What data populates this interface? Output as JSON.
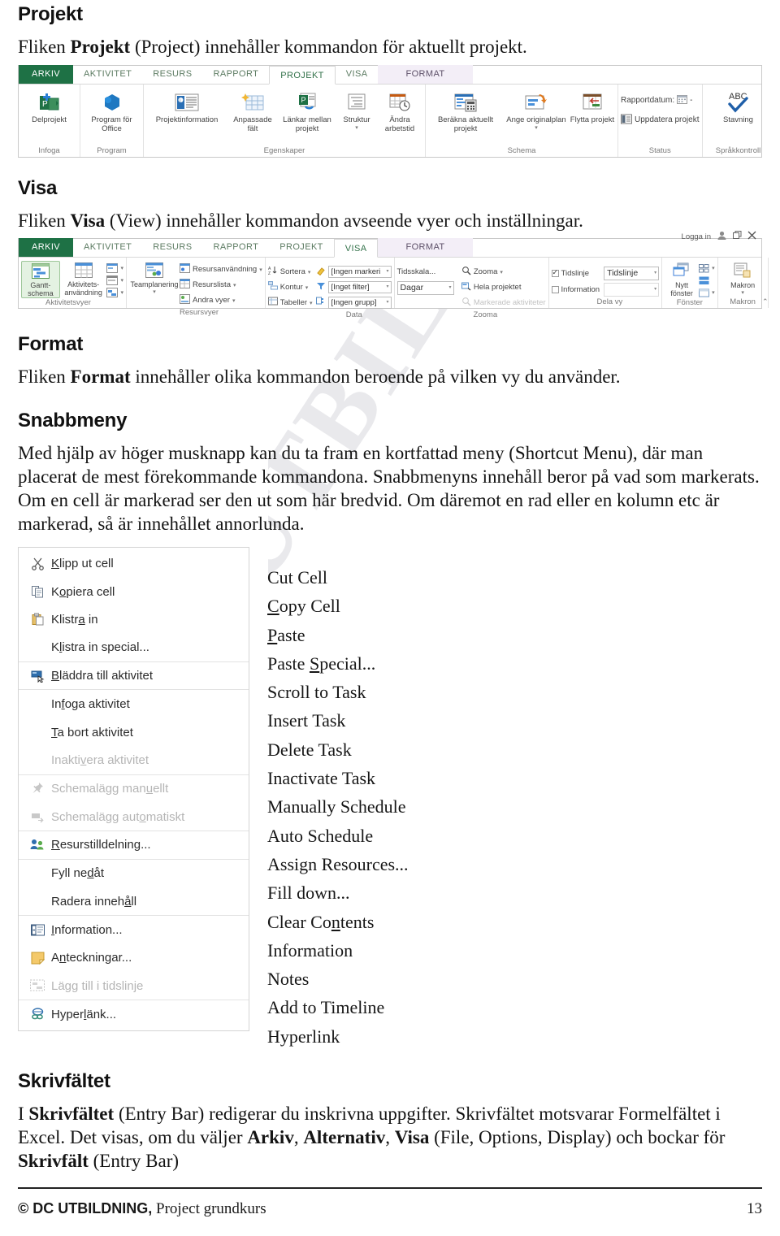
{
  "watermark": {
    "text": "UTBILDNING"
  },
  "sections": {
    "projekt": {
      "heading": "Projekt",
      "paragraph_pre": "Fliken ",
      "paragraph_bold": "Projekt",
      "paragraph_post": " (Project) innehåller kommandon för aktuellt projekt."
    },
    "visa": {
      "heading": "Visa",
      "paragraph_pre": "Fliken ",
      "paragraph_bold": "Visa",
      "paragraph_post": " (View) innehåller kommandon avseende vyer och inställningar."
    },
    "format": {
      "heading": "Format",
      "paragraph_pre": "Fliken ",
      "paragraph_bold": "Format",
      "paragraph_post": " innehåller olika kommandon beroende på vilken vy du använder."
    },
    "snabbmeny": {
      "heading": "Snabbmeny",
      "paragraph": "Med hjälp av höger musknapp kan du ta fram en kortfattad meny (Shortcut Menu), där man placerat de mest förekommande kommandona. Snabbmenyns innehåll beror på vad som markerats. Om en cell är markerad ser den ut som här bredvid. Om däremot en rad eller en kolumn etc är markerad, så är innehållet annorlunda."
    },
    "skrivfaltet": {
      "heading": "Skrivfältet",
      "p1_pre": "I ",
      "p1_b1": "Skrivfältet",
      "p1_mid1": " (Entry Bar) redigerar du inskrivna uppgifter. Skrivfältet motsvarar Formelfältet i Excel. Det visas, om du väljer ",
      "p1_b2": "Arkiv",
      "p1_sep1": ", ",
      "p1_b3": "Alternativ",
      "p1_sep2": ", ",
      "p1_b4": "Visa",
      "p1_mid2": " (File, Options, Display) och bockar för ",
      "p1_b5": "Skrivfält",
      "p1_end": " (Entry Bar)"
    }
  },
  "ribbon_projekt": {
    "tabs": [
      {
        "label": "ARKIV",
        "state": "file"
      },
      {
        "label": "AKTIVITET",
        "state": "normal"
      },
      {
        "label": "RESURS",
        "state": "normal"
      },
      {
        "label": "RAPPORT",
        "state": "normal"
      },
      {
        "label": "PROJEKT",
        "state": "active"
      },
      {
        "label": "VISA",
        "state": "normal"
      },
      {
        "label": "FORMAT",
        "state": "contextual"
      }
    ],
    "groups": [
      {
        "name": "Infoga",
        "buttons": [
          {
            "label": "Delprojekt",
            "icon": "subproject-icon"
          }
        ]
      },
      {
        "name": "Program",
        "buttons": [
          {
            "label": "Program för Office",
            "icon": "office-addin-icon",
            "dropdown": true
          }
        ]
      },
      {
        "name": "Egenskaper",
        "buttons": [
          {
            "label": "Projektinformation",
            "icon": "project-information-icon"
          },
          {
            "label": "Anpassade fält",
            "icon": "custom-fields-icon"
          },
          {
            "label": "Länkar mellan projekt",
            "icon": "links-between-projects-icon"
          },
          {
            "label": "Struktur",
            "icon": "wbs-icon",
            "dropdown": true
          },
          {
            "label": "Ändra arbetstid",
            "icon": "change-working-time-icon"
          }
        ]
      },
      {
        "name": "Schema",
        "buttons": [
          {
            "label": "Beräkna aktuellt projekt",
            "icon": "calculate-project-icon"
          },
          {
            "label": "Ange originalplan",
            "icon": "set-baseline-icon",
            "dropdown": true
          },
          {
            "label": "Flytta projekt",
            "icon": "move-project-icon"
          }
        ]
      },
      {
        "name": "Status",
        "rows": [
          {
            "label": "Rapportdatum:",
            "icon": "calendar-icon",
            "trailing": "-"
          },
          {
            "label": "Uppdatera projekt",
            "icon": "update-project-icon"
          }
        ]
      },
      {
        "name": "Språkkontroll",
        "buttons": [
          {
            "label": "Stavning",
            "icon": "spelling-abc-icon"
          }
        ]
      }
    ]
  },
  "ribbon_visa": {
    "tabs": [
      {
        "label": "ARKIV",
        "state": "file"
      },
      {
        "label": "AKTIVITET",
        "state": "normal"
      },
      {
        "label": "RESURS",
        "state": "normal"
      },
      {
        "label": "RAPPORT",
        "state": "normal"
      },
      {
        "label": "PROJEKT",
        "state": "normal"
      },
      {
        "label": "VISA",
        "state": "active"
      },
      {
        "label": "FORMAT",
        "state": "contextual"
      }
    ],
    "window": {
      "signin": "Logga in",
      "account_icon": "account-icon",
      "restore_icon": "restore-icon",
      "close_icon": "close-icon",
      "collapse_icon": "collapse-ribbon-icon"
    },
    "groups": {
      "aktivitetsvyer": {
        "name": "Aktivitetsvyer",
        "gantt": "Gantt-schema",
        "usage": "Aktivitets-användning",
        "small_icons": [
          "task-view-1-icon",
          "task-view-2-icon",
          "task-view-3-icon"
        ]
      },
      "resursvyer": {
        "name": "Resursvyer",
        "teamplanner": "Teamplanering",
        "items": [
          {
            "label": "Resursanvändning",
            "icon": "resource-usage-icon"
          },
          {
            "label": "Resurslista",
            "icon": "resource-sheet-icon"
          },
          {
            "label": "Andra vyer",
            "icon": "other-views-icon"
          }
        ]
      },
      "data": {
        "name": "Data",
        "items": [
          {
            "label": "Sortera",
            "icon": "sort-icon"
          },
          {
            "label": "Kontur",
            "icon": "outline-icon"
          },
          {
            "label": "Tabeller",
            "icon": "tables-icon"
          }
        ],
        "combos": [
          {
            "value": "[Ingen markeri",
            "icon": "highlight-icon"
          },
          {
            "value": "[Inget filter]",
            "icon": "filter-icon"
          },
          {
            "value": "[Ingen grupp]",
            "icon": "group-icon"
          }
        ]
      },
      "zooma": {
        "name": "Zooma",
        "timescale_label": "Tidsskala...",
        "timescale_value": "Dagar",
        "items": [
          {
            "label": "Zooma",
            "icon": "zoom-icon",
            "dropdown": true,
            "dim": false
          },
          {
            "label": "Hela projektet",
            "icon": "entire-project-icon",
            "dim": false
          },
          {
            "label": "Markerade aktiviteter",
            "icon": "selected-tasks-icon",
            "dim": true
          }
        ]
      },
      "delavy": {
        "name": "Dela vy",
        "checkboxes": [
          {
            "label": "Tidslinje",
            "checked": true
          },
          {
            "label": "Information",
            "checked": false
          }
        ],
        "combos": [
          {
            "value": "Tidslinje",
            "enabled": true
          },
          {
            "value": "",
            "enabled": false
          }
        ]
      },
      "fonster": {
        "name": "Fönster",
        "newwindow": "Nytt fönster",
        "small_icons": [
          "arrange-all-icon",
          "split-icon",
          "hide-icon"
        ]
      },
      "makron": {
        "name": "Makron",
        "label": "Makron",
        "dropdown": true
      }
    }
  },
  "context_menu": {
    "items": [
      {
        "sv": "Klipp ut cell",
        "sv_u": "K",
        "en": "Cut Cell",
        "en_u": "",
        "icon": "cut-icon",
        "dim": false,
        "sep": false
      },
      {
        "sv": "Kopiera cell",
        "sv_u": "o",
        "en": "Copy Cell",
        "en_u": "C",
        "icon": "copy-icon",
        "dim": false,
        "sep": false
      },
      {
        "sv": "Klistra in",
        "sv_u": "a",
        "en": "Paste",
        "en_u": "P",
        "icon": "paste-icon",
        "dim": false,
        "sep": false
      },
      {
        "sv": "Klistra in special...",
        "sv_u": "l",
        "en": "Paste Special...",
        "en_u": "S",
        "icon": "",
        "dim": false,
        "sep": true
      },
      {
        "sv": "Bläddra till aktivitet",
        "sv_u": "B",
        "en": "Scroll to Task",
        "en_u": "",
        "icon": "scroll-to-task-icon",
        "dim": false,
        "sep": true
      },
      {
        "sv": "Infoga aktivitet",
        "sv_u": "f",
        "en": "Insert Task",
        "en_u": "",
        "icon": "",
        "dim": false,
        "sep": false
      },
      {
        "sv": "Ta bort aktivitet",
        "sv_u": "T",
        "en": "Delete Task",
        "en_u": "",
        "icon": "",
        "dim": false,
        "sep": false
      },
      {
        "sv": "Inaktivera aktivitet",
        "sv_u": "v",
        "en": "Inactivate Task",
        "en_u": "",
        "icon": "",
        "dim": true,
        "sep": true
      },
      {
        "sv": "Schemalägg manuellt",
        "sv_u": "u",
        "en": "Manually Schedule",
        "en_u": "",
        "icon": "pin-icon",
        "dim": true,
        "sep": false
      },
      {
        "sv": "Schemalägg automatiskt",
        "sv_u": "o",
        "en": "Auto Schedule",
        "en_u": "",
        "icon": "auto-schedule-icon",
        "dim": true,
        "sep": true
      },
      {
        "sv": "Resurstilldelning...",
        "sv_u": "R",
        "en": "Assign Resources...",
        "en_u": "",
        "icon": "assign-resources-icon",
        "dim": false,
        "sep": true
      },
      {
        "sv": "Fyll nedåt",
        "sv_u": "d",
        "en": "Fill down...",
        "en_u": "",
        "icon": "",
        "dim": false,
        "sep": false
      },
      {
        "sv": "Radera innehåll",
        "sv_u": "å",
        "en": "Clear Contents",
        "en_u": "n",
        "icon": "",
        "dim": false,
        "sep": true
      },
      {
        "sv": "Information...",
        "sv_u": "I",
        "en": "Information",
        "en_u": "",
        "icon": "information-icon",
        "dim": false,
        "sep": false
      },
      {
        "sv": "Anteckningar...",
        "sv_u": "n",
        "en": "Notes",
        "en_u": "",
        "icon": "notes-icon",
        "dim": false,
        "sep": false
      },
      {
        "sv": "Lägg till i tidslinje",
        "sv_u": "",
        "en": "Add to Timeline",
        "en_u": "",
        "icon": "add-to-timeline-icon",
        "dim": true,
        "sep": true
      },
      {
        "sv": "Hyperlänk...",
        "sv_u": "l",
        "en": "Hyperlink",
        "en_u": "",
        "icon": "hyperlink-icon",
        "dim": false,
        "sep": false
      }
    ]
  },
  "footer": {
    "copyright_symbol": "©",
    "company": "DC UTBILDNING,",
    "course": " Project grundkurs",
    "page_number": "13"
  },
  "colors": {
    "file_tab_green": "#1e7145",
    "active_tab_text": "#33724a",
    "contextual_tab_bg": "#f3eef7",
    "selected_button_bg": "#e4f2e2",
    "watermark_gray": "#e9e9ec"
  }
}
